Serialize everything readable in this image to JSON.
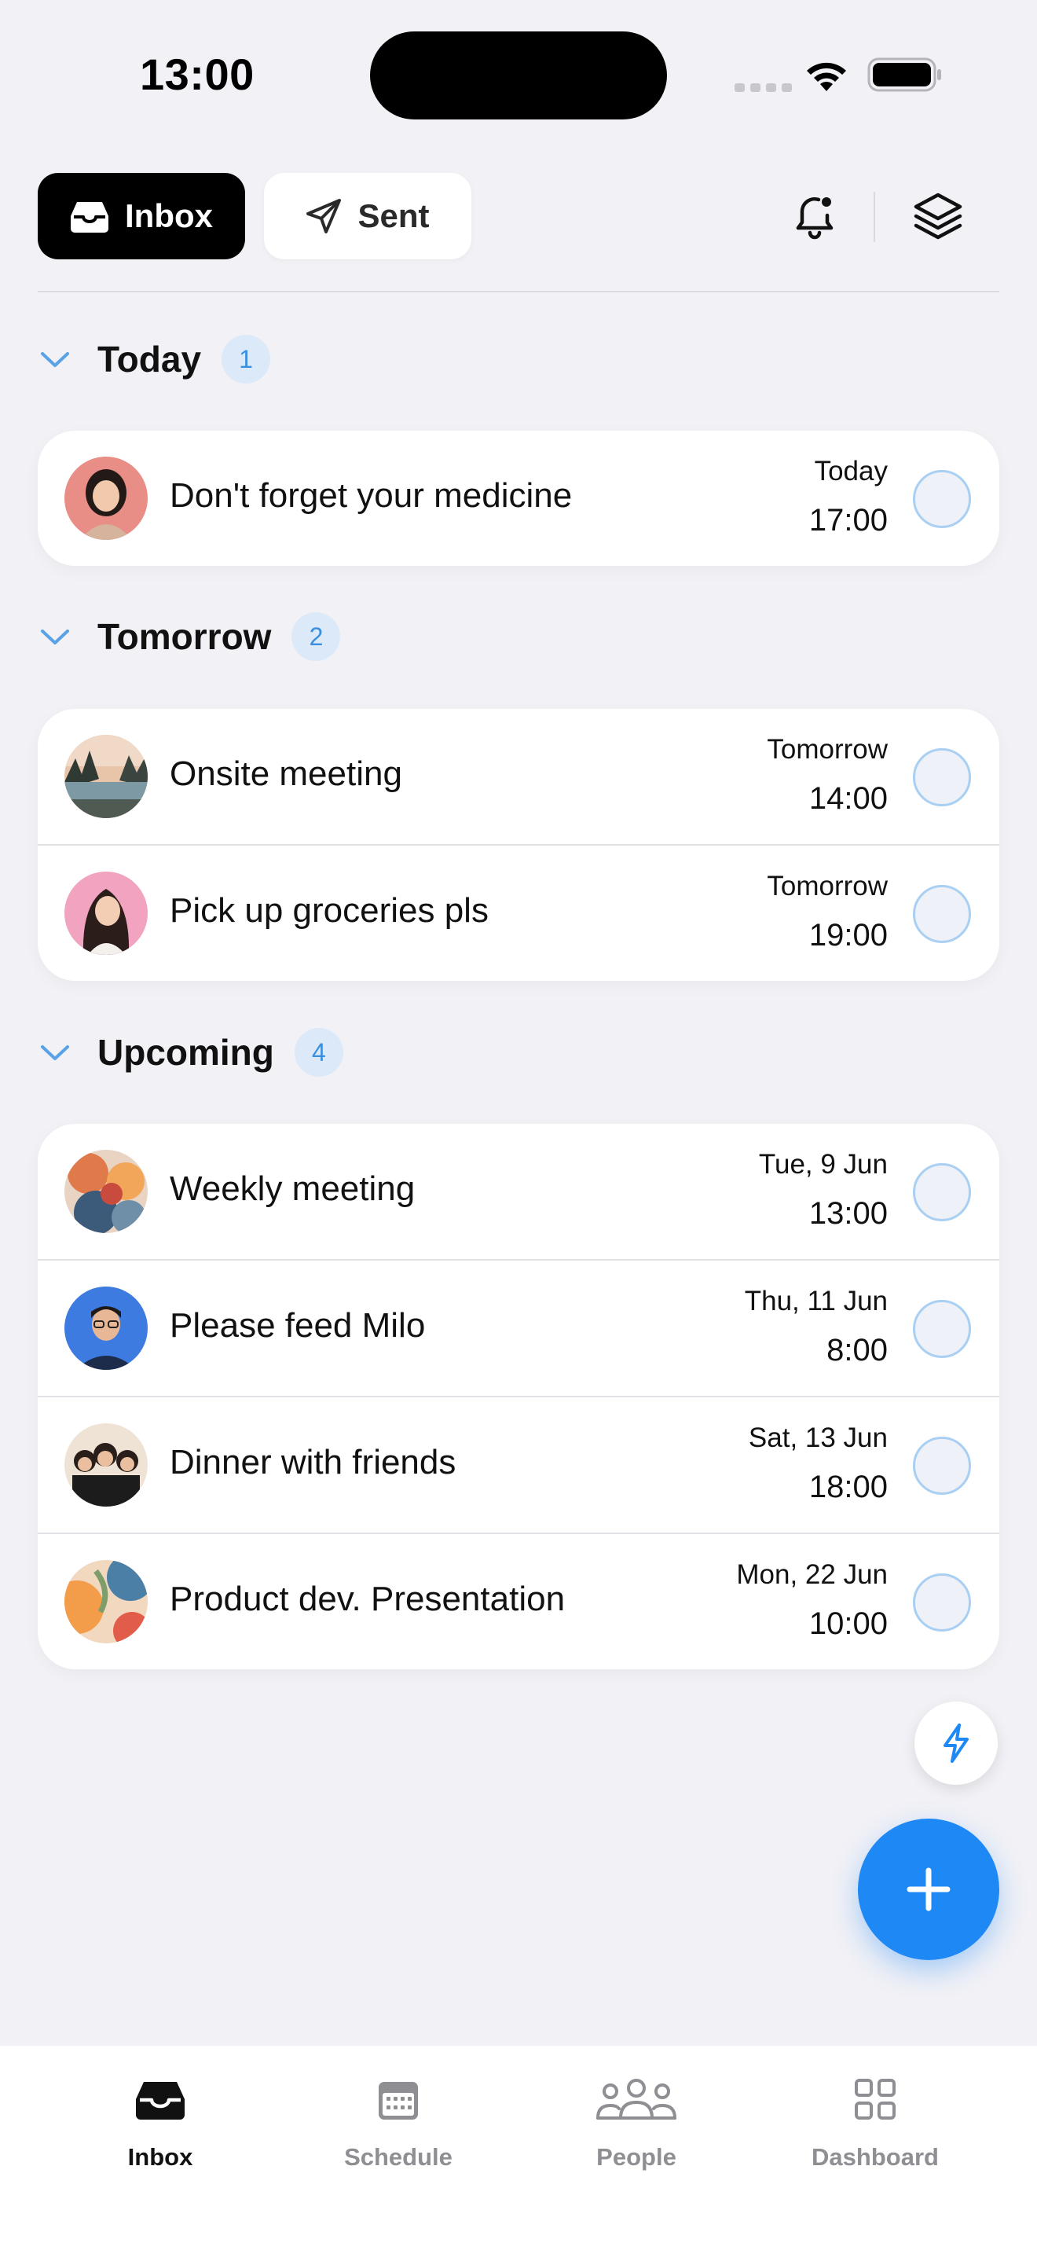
{
  "status_bar": {
    "time": "13:00"
  },
  "header": {
    "segments": [
      {
        "label": "Inbox",
        "selected": true
      },
      {
        "label": "Sent",
        "selected": false
      }
    ],
    "icons": [
      "bell-icon",
      "layers-icon"
    ]
  },
  "sections": [
    {
      "title": "Today",
      "count": "1",
      "items": [
        {
          "title": "Don't forget your medicine",
          "date": "Today",
          "time": "17:00",
          "avatar": "woman-portrait"
        }
      ]
    },
    {
      "title": "Tomorrow",
      "count": "2",
      "items": [
        {
          "title": "Onsite meeting",
          "date": "Tomorrow",
          "time": "14:00",
          "avatar": "lake-landscape"
        },
        {
          "title": "Pick up groceries pls",
          "date": "Tomorrow",
          "time": "19:00",
          "avatar": "girl-pink-background"
        }
      ]
    },
    {
      "title": "Upcoming",
      "count": "4",
      "items": [
        {
          "title": "Weekly meeting",
          "date": "Tue, 9 Jun",
          "time": "13:00",
          "avatar": "abstract-painting"
        },
        {
          "title": "Please feed Milo",
          "date": "Thu, 11 Jun",
          "time": "8:00",
          "avatar": "man-glasses"
        },
        {
          "title": "Dinner with friends",
          "date": "Sat, 13 Jun",
          "time": "18:00",
          "avatar": "group-of-friends"
        },
        {
          "title": "Product dev. Presentation",
          "date": "Mon, 22 Jun",
          "time": "10:00",
          "avatar": "abstract-shapes"
        }
      ]
    }
  ],
  "tabs": [
    {
      "label": "Inbox",
      "icon": "inbox-icon",
      "active": true
    },
    {
      "label": "Schedule",
      "icon": "calendar-icon",
      "active": false
    },
    {
      "label": "People",
      "icon": "people-icon",
      "active": false
    },
    {
      "label": "Dashboard",
      "icon": "grid-icon",
      "active": false
    }
  ],
  "colors": {
    "accent": "#1e88f5",
    "background": "#f1f1f6",
    "badge_bg": "#dce9f8",
    "badge_text": "#3b8fe0"
  }
}
